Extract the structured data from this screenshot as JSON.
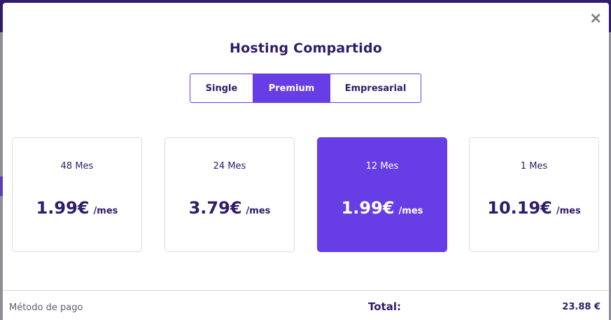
{
  "modal": {
    "title": "Hosting Compartido",
    "close_symbol": "×"
  },
  "plans": [
    {
      "label": "Single",
      "active": false
    },
    {
      "label": "Premium",
      "active": true
    },
    {
      "label": "Empresarial",
      "active": false
    }
  ],
  "periods": [
    {
      "period": "48 Mes",
      "price": "1.99€",
      "per": "/mes",
      "active": false
    },
    {
      "period": "24 Mes",
      "price": "3.79€",
      "per": "/mes",
      "active": false
    },
    {
      "period": "12 Mes",
      "price": "1.99€",
      "per": "/mes",
      "active": true
    },
    {
      "period": "1 Mes",
      "price": "10.19€",
      "per": "/mes",
      "active": false
    }
  ],
  "footer": {
    "payment_label": "Método de pago",
    "total_label": "Total:",
    "total_value": "23.88 €"
  },
  "colors": {
    "accent": "#673de6",
    "dark_text": "#2f1c6a",
    "border": "#dadce0"
  }
}
